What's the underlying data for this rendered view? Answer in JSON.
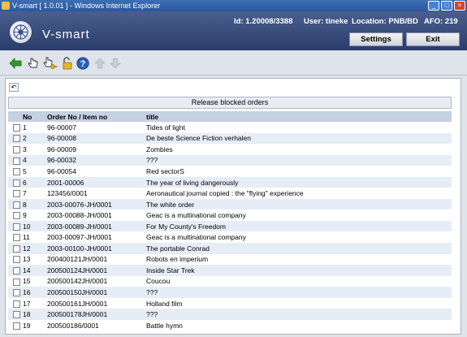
{
  "window": {
    "title": "V-smart [ 1.0.01 ] - Windows Internet Explorer"
  },
  "header": {
    "logo": "V-smart",
    "id_label": "Id: 1.20008/3388",
    "user_label": "User: tineke",
    "location_label": "Location: PNB/BD",
    "afo_label": "AFO: 219",
    "settings_label": "Settings",
    "exit_label": "Exit"
  },
  "toolbar": {
    "icons": [
      "arrow-left-icon",
      "hand-pointer-icon",
      "hand-key-icon",
      "padlock-open-icon",
      "help-icon",
      "arrow-up-icon",
      "arrow-down-icon"
    ]
  },
  "grid": {
    "title": "Release blocked orders",
    "columns": [
      "No",
      "Order No / Item no",
      "title"
    ],
    "rows": [
      {
        "no": "1",
        "order": "96-00007",
        "title": "Tides of light"
      },
      {
        "no": "2",
        "order": "96-00008",
        "title": "De beste Science Fiction verhalen"
      },
      {
        "no": "3",
        "order": "96-00009",
        "title": "Zombies"
      },
      {
        "no": "4",
        "order": "96-00032",
        "title": "???"
      },
      {
        "no": "5",
        "order": "96-00054",
        "title": "Red sectorS"
      },
      {
        "no": "6",
        "order": "2001-00006",
        "title": "The year of living dangerously"
      },
      {
        "no": "7",
        "order": "123456/0001",
        "title": "Aeronautical journal copied : the \"flying\" experience"
      },
      {
        "no": "8",
        "order": "2003-00076-JH/0001",
        "title": "The white order"
      },
      {
        "no": "9",
        "order": "2003-00088-JH/0001",
        "title": "Geac is a multinational company"
      },
      {
        "no": "10",
        "order": "2003-00089-JH/0001",
        "title": "For My County's Freedom"
      },
      {
        "no": "11",
        "order": "2003-00097-JH/0001",
        "title": "Geac is a multinational company"
      },
      {
        "no": "12",
        "order": "2003-00100-JH/0001",
        "title": "The portable Conrad"
      },
      {
        "no": "13",
        "order": "200400121JH/0001",
        "title": "Robots en imperium"
      },
      {
        "no": "14",
        "order": "200500124JH/0001",
        "title": "Inside Star Trek"
      },
      {
        "no": "15",
        "order": "200500142JH/0001",
        "title": "Coucou"
      },
      {
        "no": "16",
        "order": "200500150JH/0001",
        "title": "???"
      },
      {
        "no": "17",
        "order": "200500161JH/0001",
        "title": "Holland film"
      },
      {
        "no": "18",
        "order": "200500178JH/0001",
        "title": "???"
      },
      {
        "no": "19",
        "order": "200500186/0001",
        "title": "Battle hymn"
      }
    ]
  }
}
